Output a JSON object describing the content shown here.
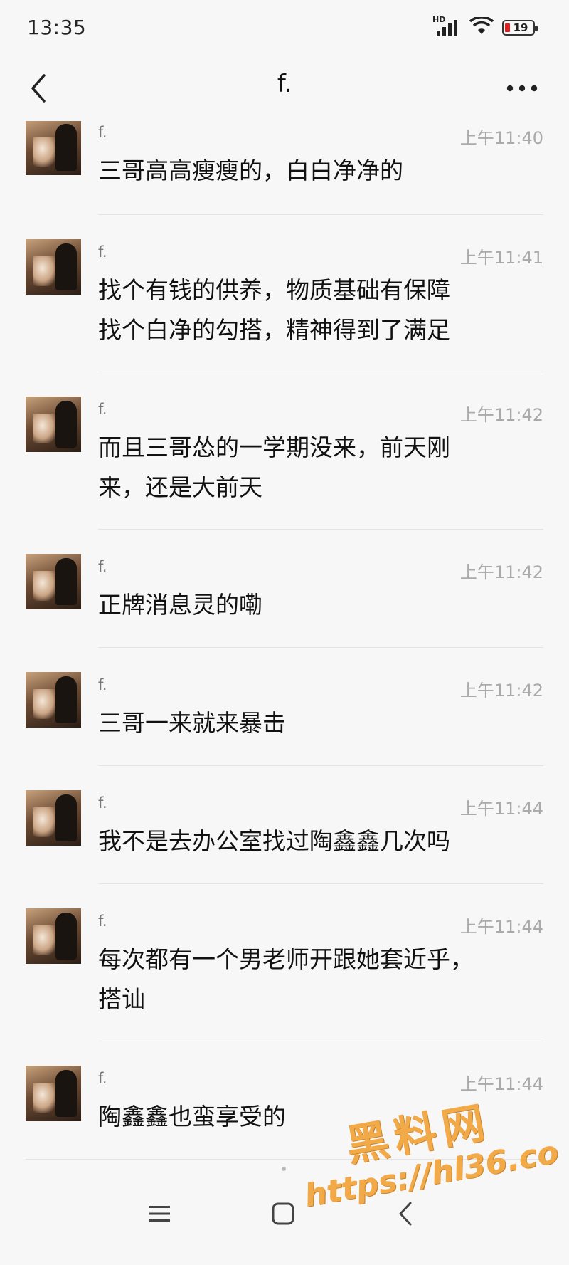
{
  "status_bar": {
    "time": "13:35",
    "signal_label": "HD",
    "battery_level": "19",
    "battery_color": "#e02020"
  },
  "header": {
    "title": "f.",
    "back_icon": "chevron-left-icon",
    "more_icon": "more-horizontal-icon"
  },
  "messages": [
    {
      "sender": "f.",
      "time": "上午11:40",
      "text": "三哥高高瘦瘦的，白白净净的"
    },
    {
      "sender": "f.",
      "time": "上午11:41",
      "text": "找个有钱的供养，物质基础有保障\n找个白净的勾搭，精神得到了满足"
    },
    {
      "sender": "f.",
      "time": "上午11:42",
      "text": "而且三哥怂的一学期没来，前天刚\n来，还是大前天"
    },
    {
      "sender": "f.",
      "time": "上午11:42",
      "text": "正牌消息灵的嘞"
    },
    {
      "sender": "f.",
      "time": "上午11:42",
      "text": "三哥一来就来暴击"
    },
    {
      "sender": "f.",
      "time": "上午11:44",
      "text": "我不是去办公室找过陶鑫鑫几次吗"
    },
    {
      "sender": "f.",
      "time": "上午11:44",
      "text": "每次都有一个男老师开跟她套近乎，\n搭讪"
    },
    {
      "sender": "f.",
      "time": "上午11:44",
      "text": "陶鑫鑫也蛮享受的"
    }
  ],
  "system_nav": {
    "menu_icon": "menu-icon",
    "home_icon": "home-square-icon",
    "back_icon": "back-triangle-icon"
  },
  "watermark": {
    "title": "黑料网",
    "url": "https://hl36.co",
    "color": "#f2a33a"
  }
}
